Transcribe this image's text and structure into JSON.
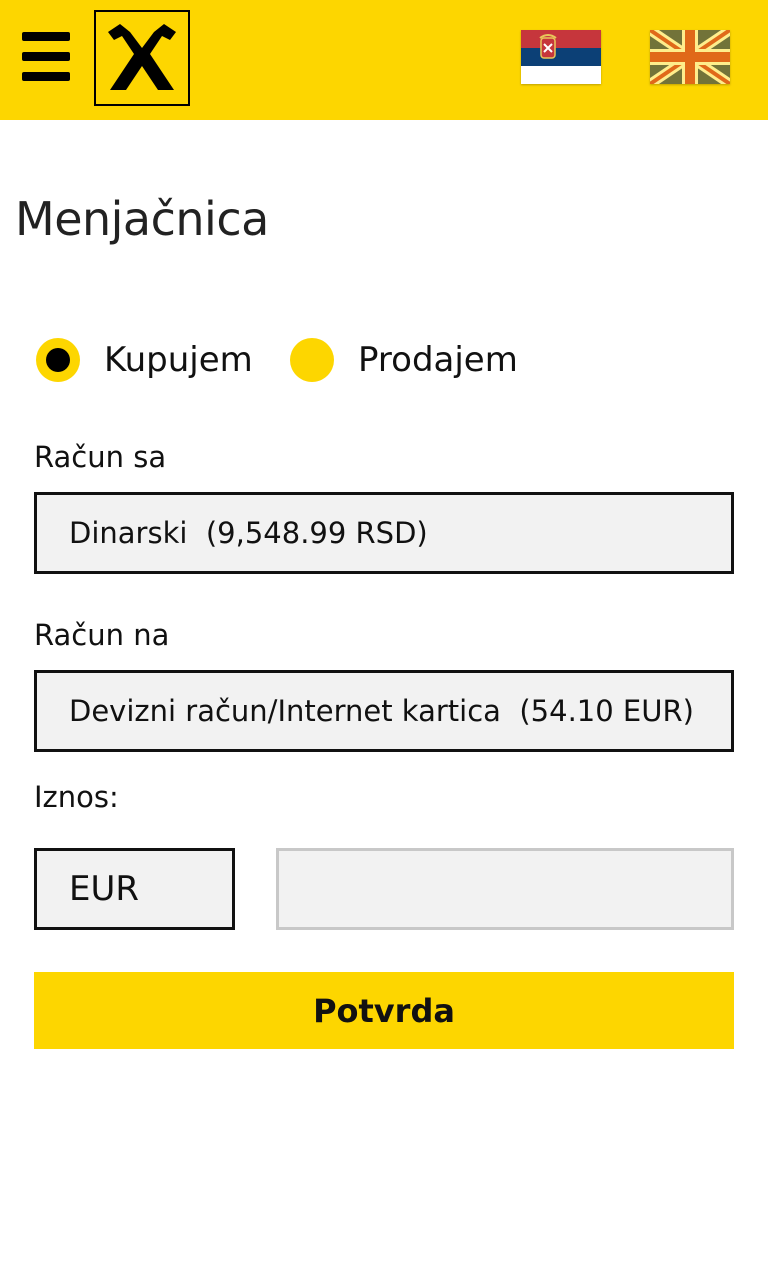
{
  "header": {
    "menu_icon": "hamburger-menu-icon",
    "logo": "raiffeisen-logo",
    "languages": [
      {
        "code": "sr",
        "icon": "serbian-flag-icon"
      },
      {
        "code": "en",
        "icon": "uk-flag-icon"
      }
    ]
  },
  "page": {
    "title": "Menjačnica"
  },
  "transaction_type": {
    "options": [
      {
        "label": "Kupujem",
        "selected": true
      },
      {
        "label": "Prodajem",
        "selected": false
      }
    ]
  },
  "from_account": {
    "label": "Račun sa",
    "value": "Dinarski  (9,548.99 RSD)"
  },
  "to_account": {
    "label": "Račun na",
    "value": "Devizni račun/Internet kartica  (54.10 EUR)"
  },
  "amount": {
    "label": "Iznos:",
    "currency": "EUR",
    "value": "",
    "placeholder": ""
  },
  "actions": {
    "confirm_label": "Potvrda"
  },
  "colors": {
    "brand_yellow": "#FDD600",
    "field_background": "#F2F2F2",
    "text": "#111111"
  }
}
